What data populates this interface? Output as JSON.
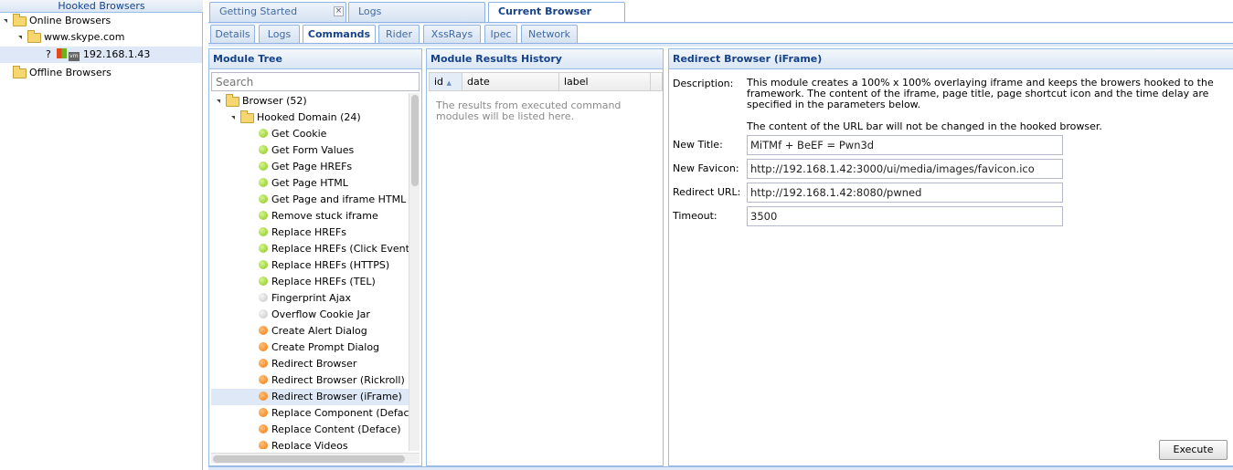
{
  "left_panel": {
    "title": "Hooked Browsers",
    "tree": {
      "online": "Online Browsers",
      "domain": "www.skype.com",
      "host_question": "?",
      "host_ip": "192.168.1.43",
      "offline": "Offline Browsers"
    }
  },
  "top_tabs": [
    "Getting Started",
    "Logs",
    "Current Browser"
  ],
  "sub_tabs": [
    "Details",
    "Logs",
    "Commands",
    "Rider",
    "XssRays",
    "Ipec",
    "Network"
  ],
  "module_tree": {
    "title": "Module Tree",
    "search_placeholder": "Search",
    "root": "Browser (52)",
    "subfolder": "Hooked Domain (24)",
    "modules": [
      {
        "label": "Get Cookie",
        "status": "green"
      },
      {
        "label": "Get Form Values",
        "status": "green"
      },
      {
        "label": "Get Page HREFs",
        "status": "green"
      },
      {
        "label": "Get Page HTML",
        "status": "green"
      },
      {
        "label": "Get Page and iframe HTML",
        "status": "green"
      },
      {
        "label": "Remove stuck iframe",
        "status": "green"
      },
      {
        "label": "Replace HREFs",
        "status": "green"
      },
      {
        "label": "Replace HREFs (Click Events)",
        "status": "green"
      },
      {
        "label": "Replace HREFs (HTTPS)",
        "status": "green"
      },
      {
        "label": "Replace HREFs (TEL)",
        "status": "green"
      },
      {
        "label": "Fingerprint Ajax",
        "status": "grey"
      },
      {
        "label": "Overflow Cookie Jar",
        "status": "grey"
      },
      {
        "label": "Create Alert Dialog",
        "status": "orange"
      },
      {
        "label": "Create Prompt Dialog",
        "status": "orange"
      },
      {
        "label": "Redirect Browser",
        "status": "orange"
      },
      {
        "label": "Redirect Browser (Rickroll)",
        "status": "orange"
      },
      {
        "label": "Redirect Browser (iFrame)",
        "status": "orange",
        "selected": true
      },
      {
        "label": "Replace Component (Deface)",
        "status": "orange"
      },
      {
        "label": "Replace Content (Deface)",
        "status": "orange"
      },
      {
        "label": "Replace Videos",
        "status": "orange"
      }
    ]
  },
  "results": {
    "title": "Module Results History",
    "columns": [
      "id",
      "date",
      "label"
    ],
    "empty_text": "The results from executed command modules will be listed here."
  },
  "command": {
    "title": "Redirect Browser (iFrame)",
    "description_label": "Description:",
    "description_p1": "This module creates a 100% x 100% overlaying iframe and keeps the browers hooked to the framework. The content of the iframe, page title, page shortcut icon and the time delay are specified in the parameters below.",
    "description_p2": "The content of the URL bar will not be changed in the hooked browser.",
    "fields": [
      {
        "label": "New Title:",
        "value": "MiTMf + BeEF = Pwn3d"
      },
      {
        "label": "New Favicon:",
        "value": "http://192.168.1.42:3000/ui/media/images/favicon.ico"
      },
      {
        "label": "Redirect URL:",
        "value": "http://192.168.1.42:8080/pwned"
      },
      {
        "label": "Timeout:",
        "value": "3500"
      }
    ],
    "execute_label": "Execute"
  }
}
